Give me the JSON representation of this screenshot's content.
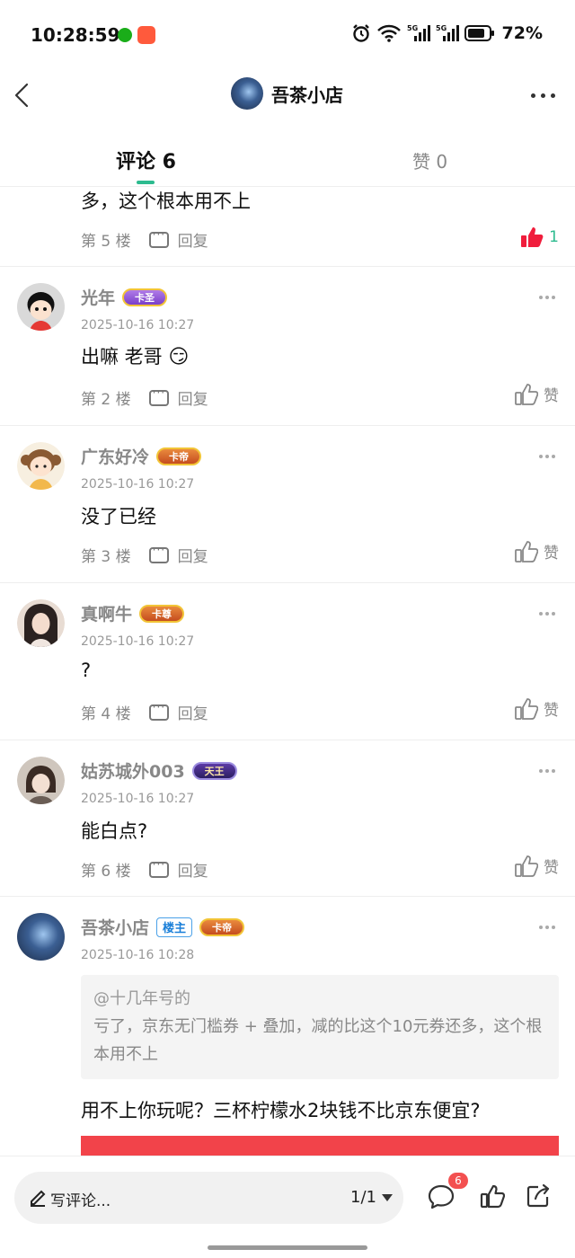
{
  "status_bar": {
    "time": "10:28:59",
    "battery": "72%"
  },
  "header": {
    "title": "吾茶小店"
  },
  "tabs": {
    "comments": "评论 6",
    "likes": "赞 0"
  },
  "comments": [
    {
      "text": "多，这个根本用不上",
      "floor": "第 5 楼",
      "reply": "回复",
      "like_count": "1"
    },
    {
      "name": "光年",
      "badge": "卡圣",
      "date": "2025-10-16 10:27",
      "text": "出嘛 老哥",
      "emoji": "😏",
      "floor": "第 2 楼",
      "reply": "回复",
      "like": "赞"
    },
    {
      "name": "广东好冷",
      "badge": "卡帝",
      "date": "2025-10-16 10:27",
      "text": "没了已经",
      "floor": "第 3 楼",
      "reply": "回复",
      "like": "赞"
    },
    {
      "name": "真啊牛",
      "badge": "卡尊",
      "date": "2025-10-16 10:27",
      "text": "?",
      "floor": "第 4 楼",
      "reply": "回复",
      "like": "赞"
    },
    {
      "name": "姑苏城外003",
      "badge": "天王",
      "date": "2025-10-16 10:27",
      "text": "能白点?",
      "floor": "第 6 楼",
      "reply": "回复",
      "like": "赞"
    },
    {
      "name": "吾茶小店",
      "tag": "楼主",
      "badge": "卡帝",
      "date": "2025-10-16 10:28",
      "quote_user": "@十几年号的",
      "quote_text": "亏了，京东无门槛券 + 叠加，减的比这个10元券还多，这个根本用不上",
      "text": "用不上你玩呢？三杯柠檬水2块钱不比京东便宜?"
    }
  ],
  "bottom_bar": {
    "placeholder": "写评论...",
    "pager": "1/1",
    "comment_badge": "6"
  },
  "colors": {
    "accent": "#2dbb8f",
    "like_red": "#f01d3c",
    "badge_red": "#f35050"
  }
}
